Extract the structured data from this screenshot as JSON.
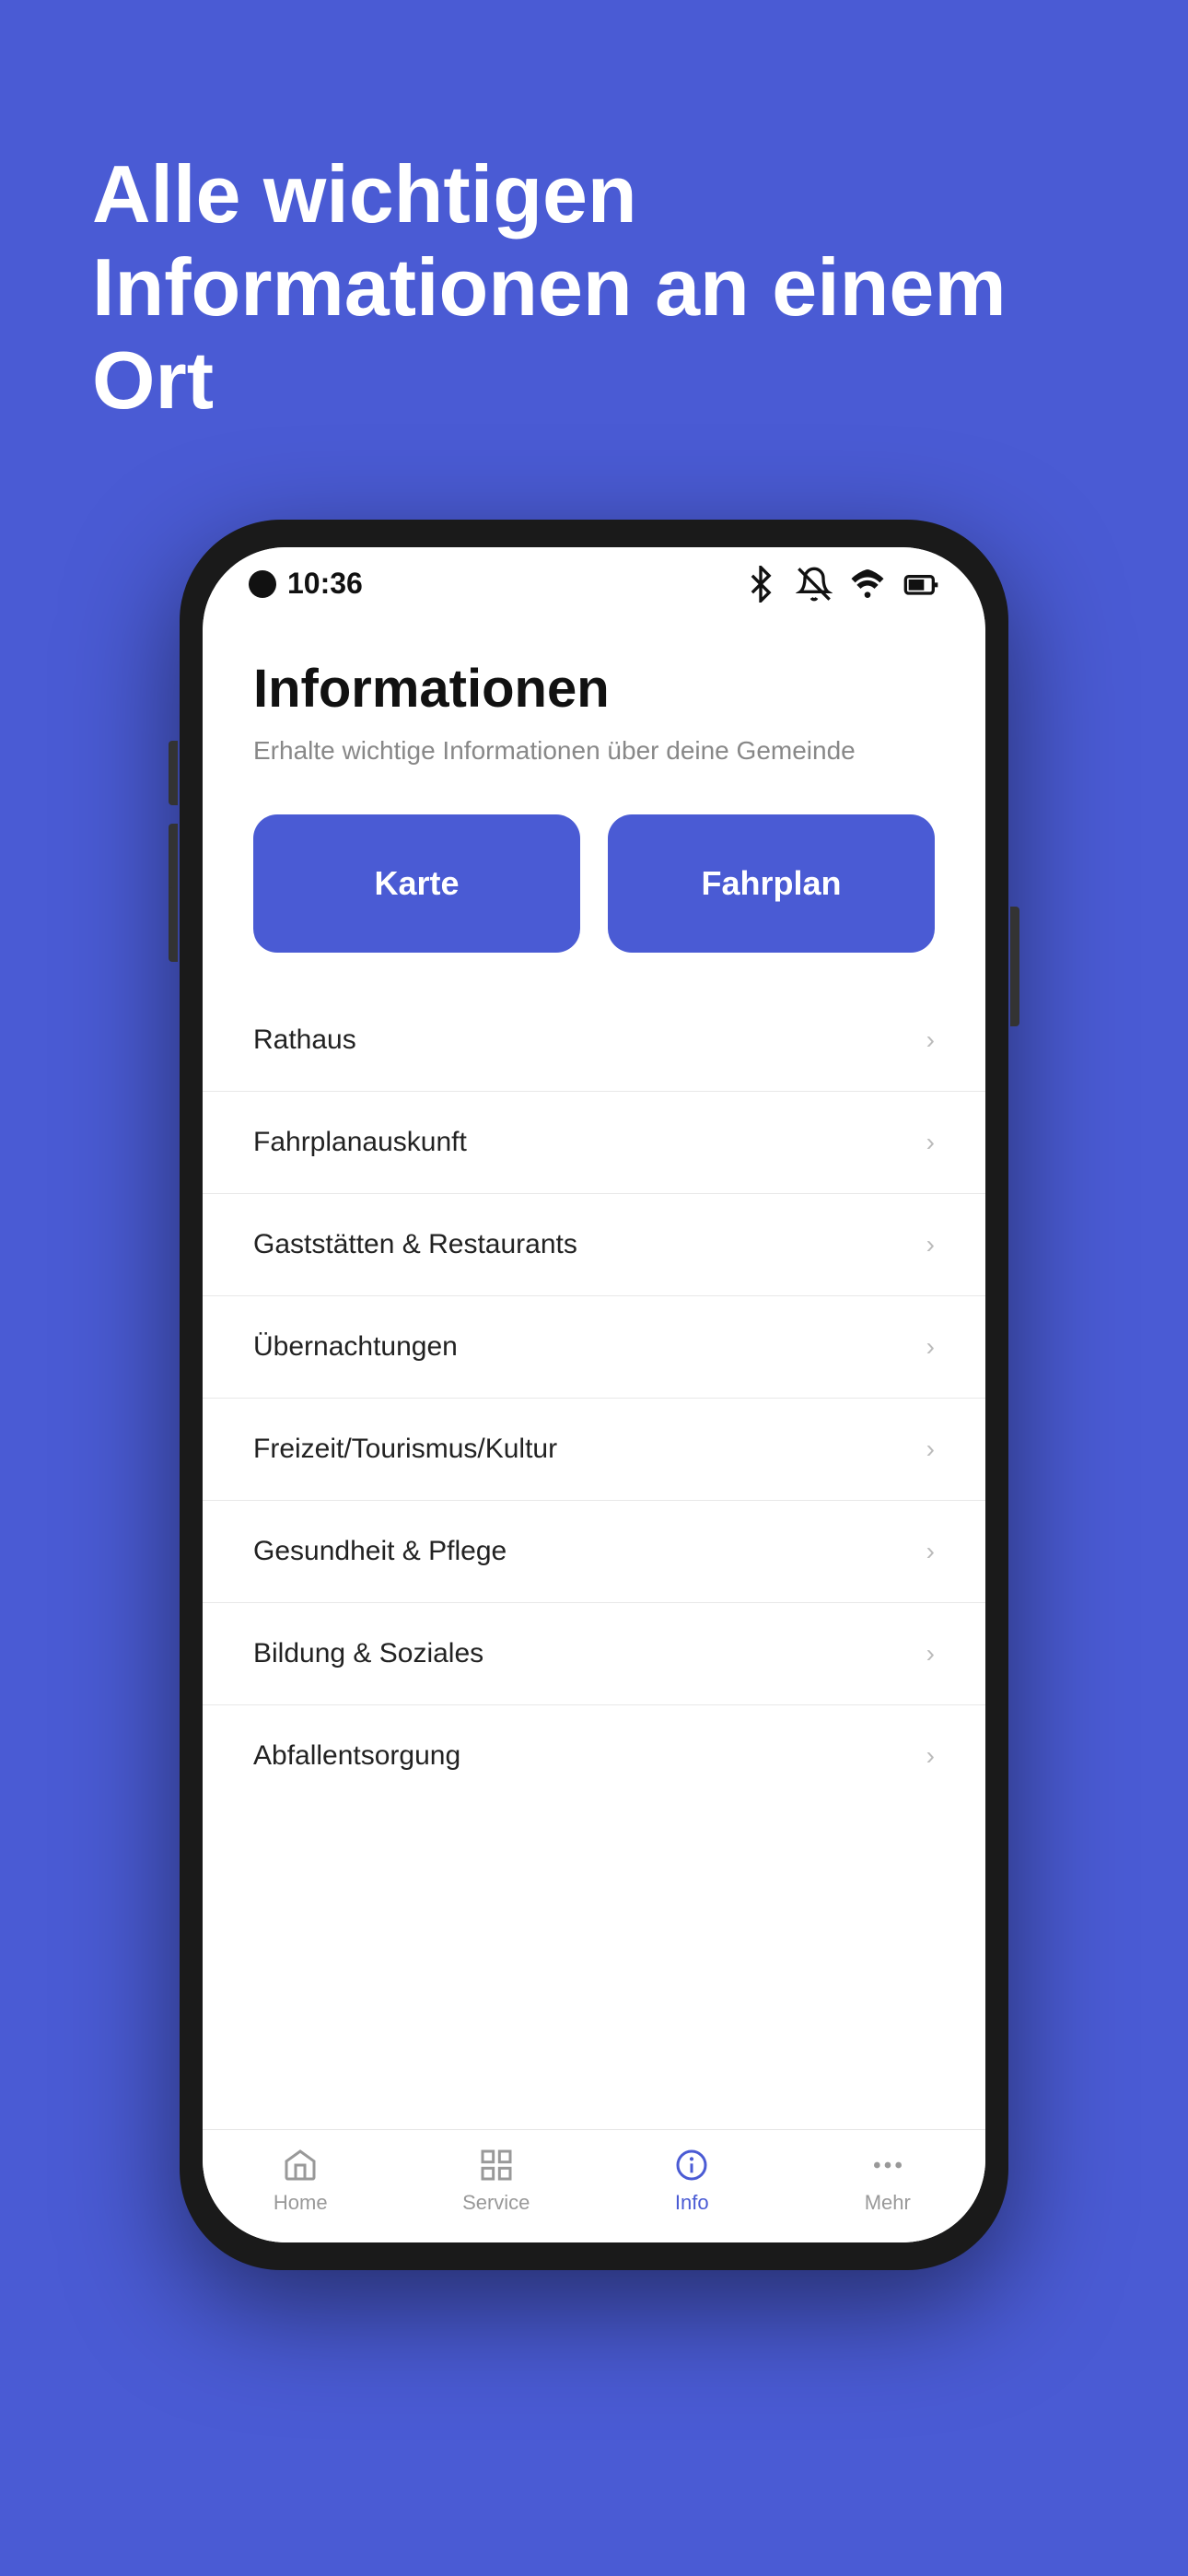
{
  "background_color": "#4A5BD4",
  "hero": {
    "title": "Alle wichtigen Informationen an einem Ort"
  },
  "status_bar": {
    "time": "10:36",
    "icons": [
      "bluetooth",
      "muted",
      "wifi",
      "battery"
    ]
  },
  "app": {
    "title": "Informationen",
    "subtitle": "Erhalte wichtige Informationen über deine Gemeinde",
    "quick_buttons": [
      {
        "label": "Karte"
      },
      {
        "label": "Fahrplan"
      }
    ],
    "menu_items": [
      {
        "label": "Rathaus"
      },
      {
        "label": "Fahrplanauskunft"
      },
      {
        "label": "Gaststätten & Restaurants"
      },
      {
        "label": "Übernachtungen"
      },
      {
        "label": "Freizeit/Tourismus/Kultur"
      },
      {
        "label": "Gesundheit & Pflege"
      },
      {
        "label": "Bildung & Soziales"
      },
      {
        "label": "Abfallentsorgung"
      }
    ]
  },
  "bottom_nav": {
    "items": [
      {
        "label": "Home",
        "icon": "home",
        "active": false
      },
      {
        "label": "Service",
        "icon": "grid",
        "active": false
      },
      {
        "label": "Info",
        "icon": "info",
        "active": true
      },
      {
        "label": "Mehr",
        "icon": "more",
        "active": false
      }
    ]
  }
}
